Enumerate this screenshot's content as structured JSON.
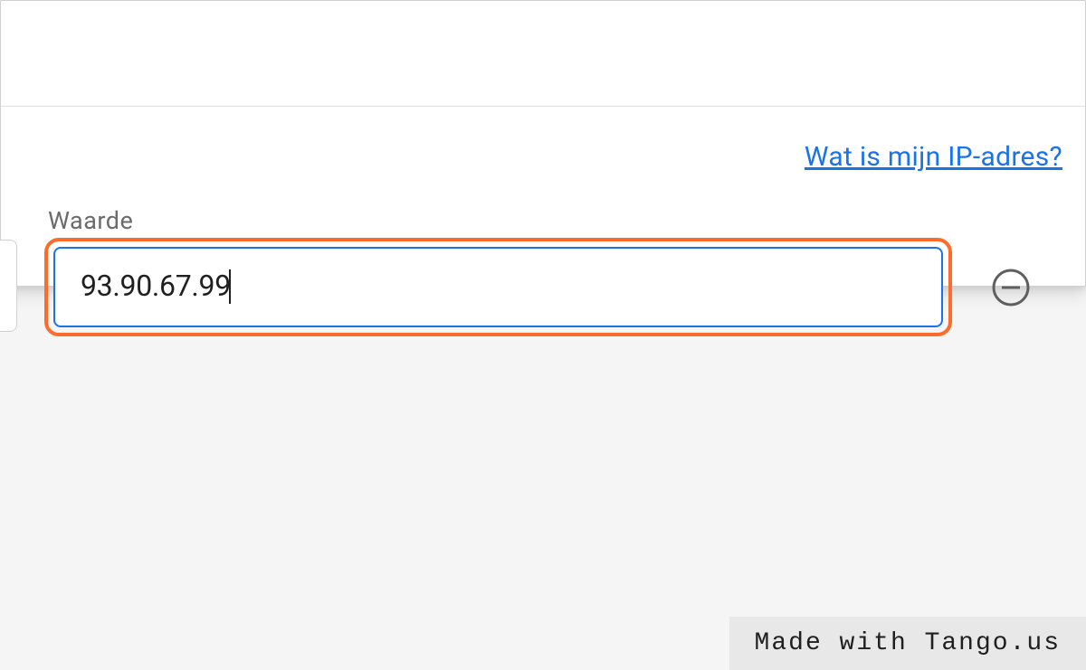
{
  "help_link": {
    "label": "Wat is mijn IP-adres?"
  },
  "field": {
    "label": "Waarde",
    "value": "93.90.67.99"
  },
  "watermark": {
    "text": "Made with Tango.us"
  },
  "colors": {
    "link": "#1a73e8",
    "highlight": "#ff6b2b",
    "input_border": "#1a73e8"
  }
}
